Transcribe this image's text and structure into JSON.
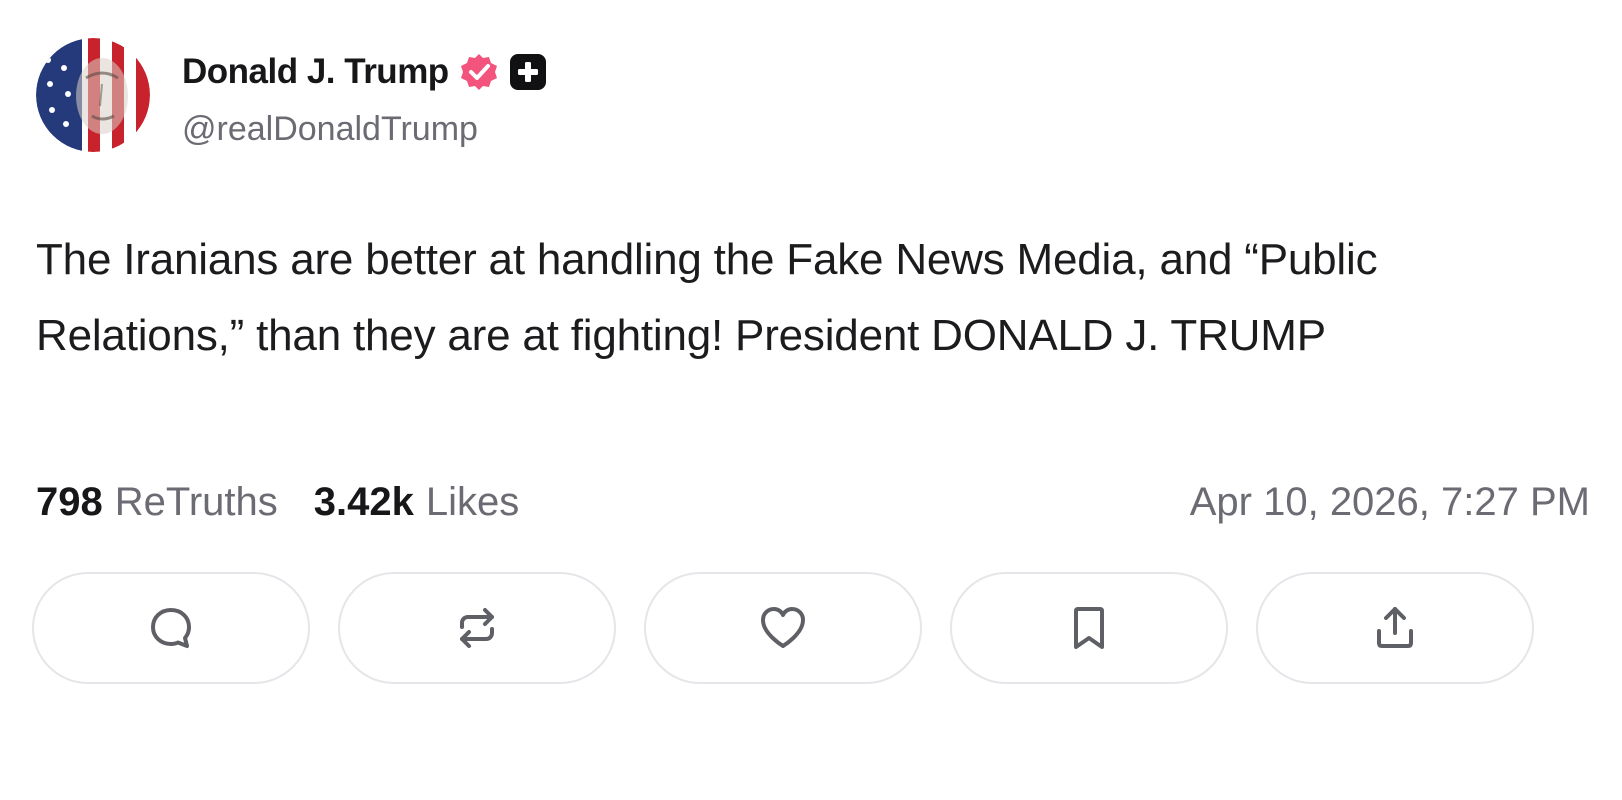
{
  "post": {
    "author": {
      "display_name": "Donald J. Trump",
      "handle": "@realDonaldTrump",
      "badges": [
        "verified-icon",
        "plus-icon"
      ],
      "verified_color": "#f2547d"
    },
    "text": "The Iranians are better at handling the Fake News Media, and “Public Relations,” than they are at fighting! President DONALD J. TRUMP",
    "stats": {
      "retruths_count": "798",
      "retruths_label": "ReTruths",
      "likes_count": "3.42k",
      "likes_label": "Likes"
    },
    "timestamp": "Apr 10, 2026, 7:27 PM",
    "actions": [
      {
        "name": "reply",
        "icon": "comment-icon"
      },
      {
        "name": "retruth",
        "icon": "repost-icon"
      },
      {
        "name": "like",
        "icon": "heart-icon"
      },
      {
        "name": "bookmark",
        "icon": "bookmark-icon"
      },
      {
        "name": "share",
        "icon": "share-icon"
      }
    ]
  },
  "colors": {
    "text_primary": "#17171a",
    "text_secondary": "#6b6b73",
    "button_border": "#e6e6ea",
    "icon": "#5f5f66"
  }
}
